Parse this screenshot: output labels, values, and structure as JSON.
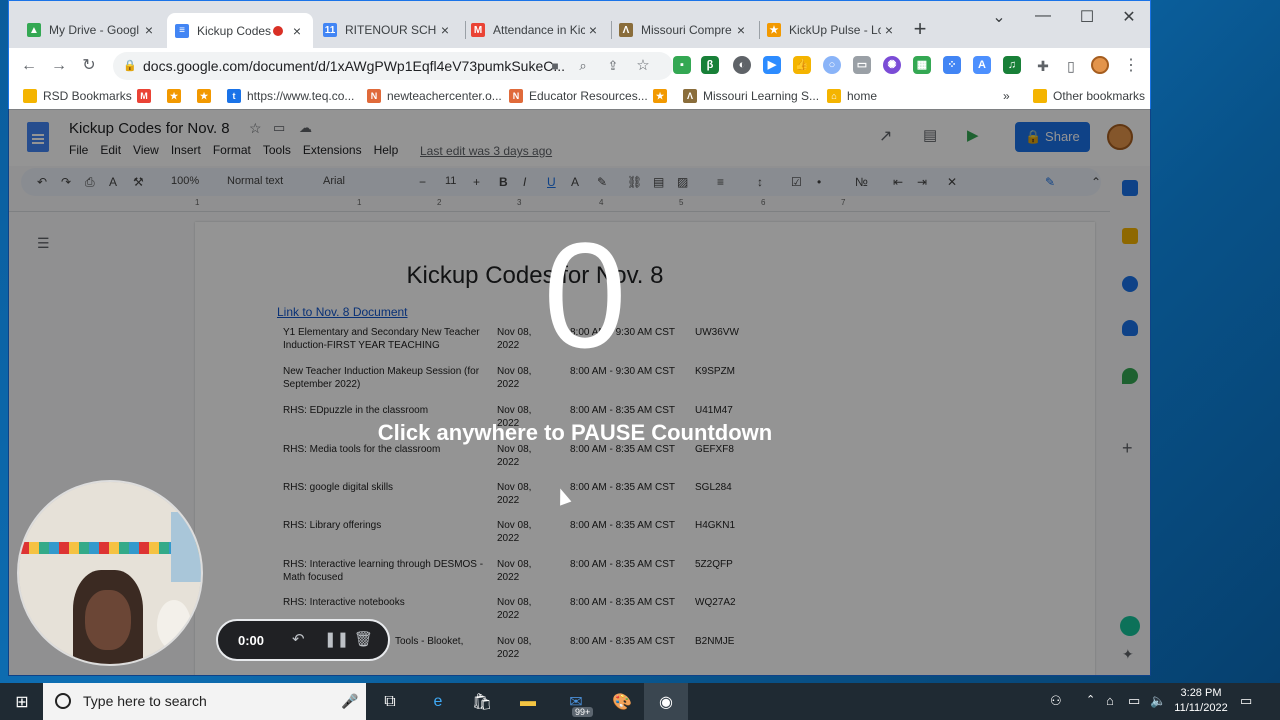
{
  "browser": {
    "tabs": [
      {
        "title": "My Drive - Googl",
        "icon": "drive-icon",
        "color": "#34a853"
      },
      {
        "title": "Kickup Codes",
        "icon": "docs-icon",
        "color": "#4285f4",
        "active": true
      },
      {
        "title": "RITENOUR SCHO",
        "icon": "calendar-icon",
        "color": "#4285f4"
      },
      {
        "title": "Attendance in Kic",
        "icon": "gmail-icon",
        "color": "#ea4335"
      },
      {
        "title": "Missouri Compre",
        "icon": "mo-icon",
        "color": "#8a6d3b"
      },
      {
        "title": "KickUp Pulse - Lo",
        "icon": "kickup-icon",
        "color": "#f29900"
      }
    ],
    "new_tab": "+",
    "url": "docs.google.com/document/d/1xAWgPWp1Eqfl4eV73pumkSukeC...",
    "bookmarks": [
      {
        "label": "RSD Bookmarks",
        "icon": "folder-icon",
        "color": "#f4b400"
      },
      {
        "label": "",
        "icon": "gmail-icon",
        "color": "#ea4335"
      },
      {
        "label": "",
        "icon": "kickup-icon",
        "color": "#f29900"
      },
      {
        "label": "",
        "icon": "kickup-icon",
        "color": "#f29900"
      },
      {
        "label": "https://www.teq.co...",
        "icon": "teq-icon",
        "color": "#1a73e8"
      },
      {
        "label": "newteachercenter.o...",
        "icon": "ntc-icon",
        "color": "#e06a3a"
      },
      {
        "label": "Educator Resources...",
        "icon": "ntc-icon",
        "color": "#e06a3a"
      },
      {
        "label": "",
        "icon": "kickup-icon",
        "color": "#f29900"
      },
      {
        "label": "Missouri Learning S...",
        "icon": "mo-icon",
        "color": "#8a6d3b"
      },
      {
        "label": "home",
        "icon": "home-icon",
        "color": "#f4b400"
      }
    ],
    "bookmarks_more": "»",
    "other_bookmarks": "Other bookmarks"
  },
  "docs": {
    "title": "Kickup Codes for Nov. 8",
    "menus": [
      "File",
      "Edit",
      "View",
      "Insert",
      "Format",
      "Tools",
      "Extensions",
      "Help"
    ],
    "last_edit": "Last edit was 3 days ago",
    "share": "Share",
    "zoom": "100%",
    "style": "Normal text",
    "font": "Arial",
    "font_size": "11",
    "ruler_ticks": [
      "1",
      "1",
      "2",
      "3",
      "4",
      "5",
      "6",
      "7"
    ],
    "heading": "Kickup Codes for Nov. 8",
    "link": "Link to Nov. 8 Document",
    "rows": [
      {
        "session": "Y1 Elementary and Secondary New Teacher Induction-FIRST YEAR TEACHING",
        "date": "Nov 08, 2022",
        "time": "8:00 AM - 9:30 AM CST",
        "code": "UW36VW"
      },
      {
        "session": "New Teacher Induction Makeup Session (for September 2022)",
        "date": "Nov 08, 2022",
        "time": "8:00 AM - 9:30 AM CST",
        "code": "K9SPZM"
      },
      {
        "session": "RHS: EDpuzzle in the classroom",
        "date": "Nov 08, 2022",
        "time": "8:00 AM - 8:35 AM CST",
        "code": "U41M47"
      },
      {
        "session": "RHS: Media tools for the classroom",
        "date": "Nov 08, 2022",
        "time": "8:00 AM - 8:35 AM CST",
        "code": "GEFXF8"
      },
      {
        "session": "RHS: google digital skills",
        "date": "Nov 08, 2022",
        "time": "8:00 AM - 8:35 AM CST",
        "code": "SGL284"
      },
      {
        "session": "RHS: Library offerings",
        "date": "Nov 08, 2022",
        "time": "8:00 AM - 8:35 AM CST",
        "code": "H4GKN1"
      },
      {
        "session": "RHS: Interactive learning through DESMOS - Math focused",
        "date": "Nov 08, 2022",
        "time": "8:00 AM - 8:35 AM CST",
        "code": "5Z2QFP"
      },
      {
        "session": "RHS: Interactive notebooks",
        "date": "Nov 08, 2022",
        "time": "8:00 AM - 8:35 AM CST",
        "code": "WQ27A2"
      },
      {
        "session": "Tools - Blooket,",
        "date": "Nov 08, 2022",
        "time": "8:00 AM - 8:35 AM CST",
        "code": "B2NMJE"
      }
    ]
  },
  "overlay": {
    "countdown": "0",
    "message": "Click anywhere to PAUSE Countdown"
  },
  "recorder": {
    "time": "0:00"
  },
  "taskbar": {
    "search_placeholder": "Type here to search",
    "mail_badge": "99+",
    "time": "3:28 PM",
    "date": "11/11/2022"
  }
}
